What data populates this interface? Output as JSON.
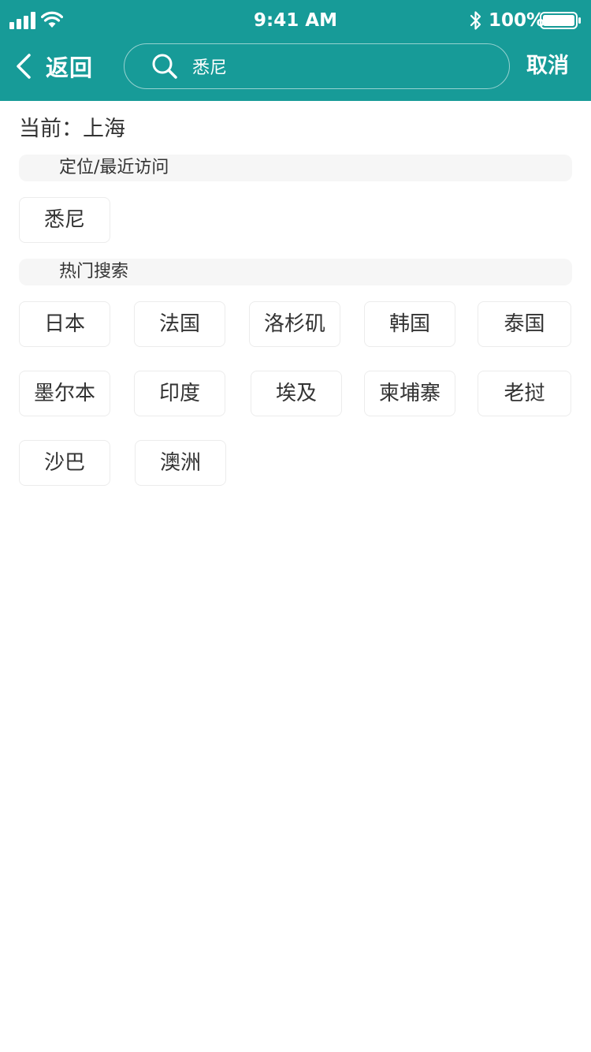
{
  "status_bar": {
    "time": "9:41 AM",
    "battery": "100%",
    "icons": [
      "signal-icon",
      "wifi-icon",
      "bluetooth-icon",
      "battery-icon"
    ]
  },
  "nav": {
    "back_label": "返回",
    "search_value": "悉尼",
    "search_placeholder": "",
    "cancel_label": "取消"
  },
  "current": {
    "text": "当前：上海"
  },
  "recent": {
    "title": "定位/最近访问",
    "items": [
      "悉尼"
    ]
  },
  "hot": {
    "title": "热门搜索",
    "items": [
      "日本",
      "法国",
      "洛杉矶",
      "韩国",
      "泰国",
      "墨尔本",
      "印度",
      "埃及",
      "柬埔寨",
      "老挝",
      "沙巴",
      "澳洲"
    ]
  },
  "colors": {
    "header": "#179b98",
    "section_bg": "#f6f6f6",
    "chip_border": "#ececec"
  }
}
